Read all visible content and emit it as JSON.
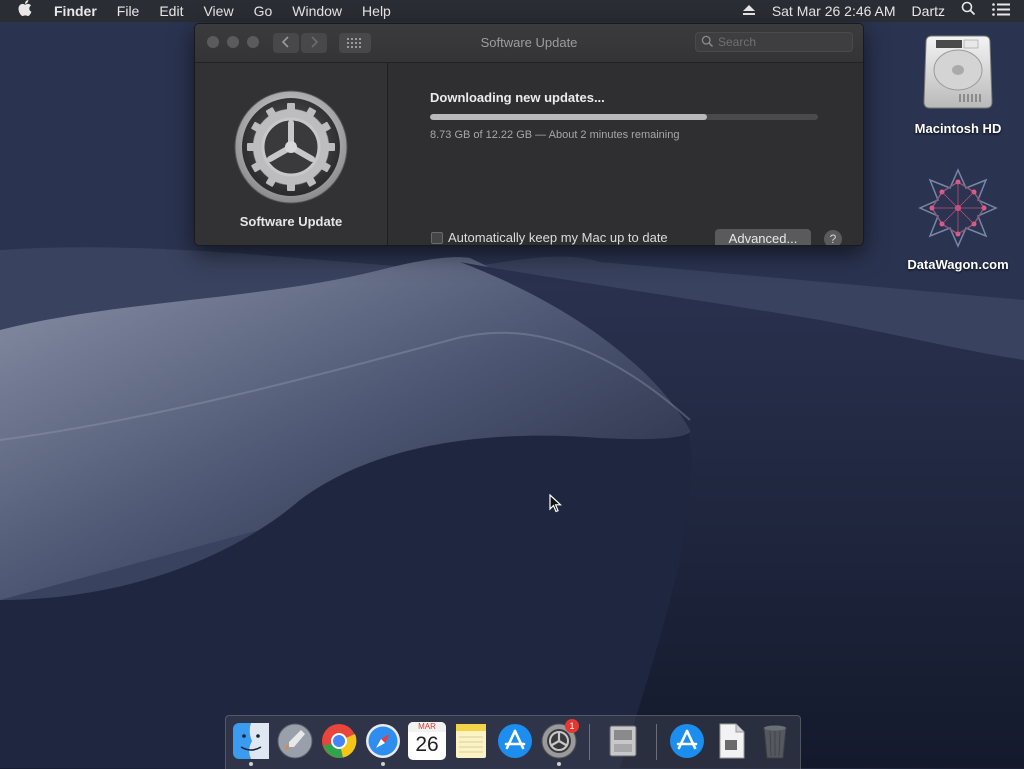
{
  "menubar": {
    "app_name": "Finder",
    "items": [
      "File",
      "Edit",
      "View",
      "Go",
      "Window",
      "Help"
    ],
    "clock": "Sat Mar 26  2:46 AM",
    "user": "Dartz"
  },
  "window": {
    "title": "Software Update",
    "search_placeholder": "Search",
    "sidebar_label": "Software Update",
    "status": "Downloading new updates...",
    "progress_fraction": 0.714,
    "progress_text": "8.73 GB of 12.22 GB — About 2 minutes remaining",
    "auto_update_label": "Automatically keep my Mac up to date",
    "auto_update_checked": false,
    "advanced_label": "Advanced...",
    "help_label": "?"
  },
  "desktop": {
    "icons": [
      {
        "label": "Macintosh HD",
        "icon": "hard-drive-icon"
      },
      {
        "label": "DataWagon.com",
        "icon": "datawagon-logo-icon"
      }
    ]
  },
  "dock": {
    "calendar_month": "MAR",
    "calendar_day": "26",
    "system_prefs_badge": "1",
    "apps": [
      "finder-icon",
      "launchpad-icon",
      "chrome-icon",
      "safari-icon",
      "calendar-icon",
      "notes-icon",
      "app-store-icon",
      "system-preferences-icon",
      "disk-utility-icon",
      "app-store-downloads-icon",
      "document-icon",
      "trash-icon"
    ]
  },
  "colors": {
    "accent": "#b9b9bb",
    "window_bg": "#2f2f31",
    "menubar_bg": "#2a2d33"
  }
}
